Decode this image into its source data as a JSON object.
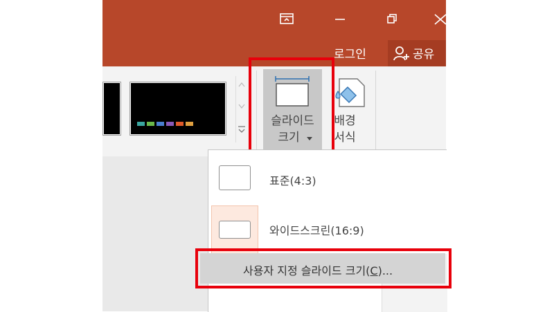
{
  "window": {
    "restore_ribbon_icon": "ribbon-display-options-icon",
    "minimize_icon": "minimize-icon",
    "maximize_icon": "restore-icon",
    "close_icon": "close-icon"
  },
  "account": {
    "login_label": "로그인",
    "share_label": "공유"
  },
  "ribbon": {
    "slide_size_line1": "슬라이드",
    "slide_size_line2": "크기",
    "format_bg_line1": "배경",
    "format_bg_line2": "서식",
    "theme_colors": [
      "#3aa6a0",
      "#6bb84a",
      "#4a7fd0",
      "#8a5ab8",
      "#e05a2a",
      "#e0a040"
    ]
  },
  "menu": {
    "items": [
      {
        "label": "표준(4:3)"
      },
      {
        "label": "와이드스크린(16:9)"
      }
    ],
    "custom_prefix": "사용자 지정 슬라이드 크기(",
    "custom_accel": "C",
    "custom_suffix": ")..."
  },
  "colors": {
    "titlebar": "#b7472a",
    "highlight_red": "#e8000b"
  }
}
